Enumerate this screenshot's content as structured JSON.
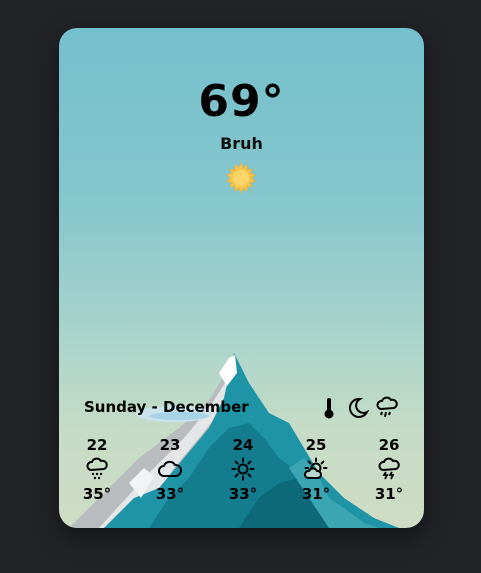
{
  "current": {
    "temperature": "69°",
    "condition": "Bruh",
    "icon": "sun-icon"
  },
  "date_label": "Sunday - December",
  "mode_icons": [
    "thermometer-icon",
    "moon-icon",
    "rain-cloud-icon"
  ],
  "forecast": [
    {
      "day": "22",
      "temp": "35°",
      "icon": "snow-cloud-icon"
    },
    {
      "day": "23",
      "temp": "33°",
      "icon": "cloud-icon"
    },
    {
      "day": "24",
      "temp": "33°",
      "icon": "sun-icon"
    },
    {
      "day": "25",
      "temp": "31°",
      "icon": "partly-sunny-icon"
    },
    {
      "day": "26",
      "temp": "31°",
      "icon": "thunderstorm-icon"
    }
  ],
  "colors": {
    "background": "#222327",
    "sky_top": "#74c0cc",
    "sky_bottom": "#cfdcc3",
    "mountain": "#1f8ea0",
    "sun": "#f7c54a"
  }
}
